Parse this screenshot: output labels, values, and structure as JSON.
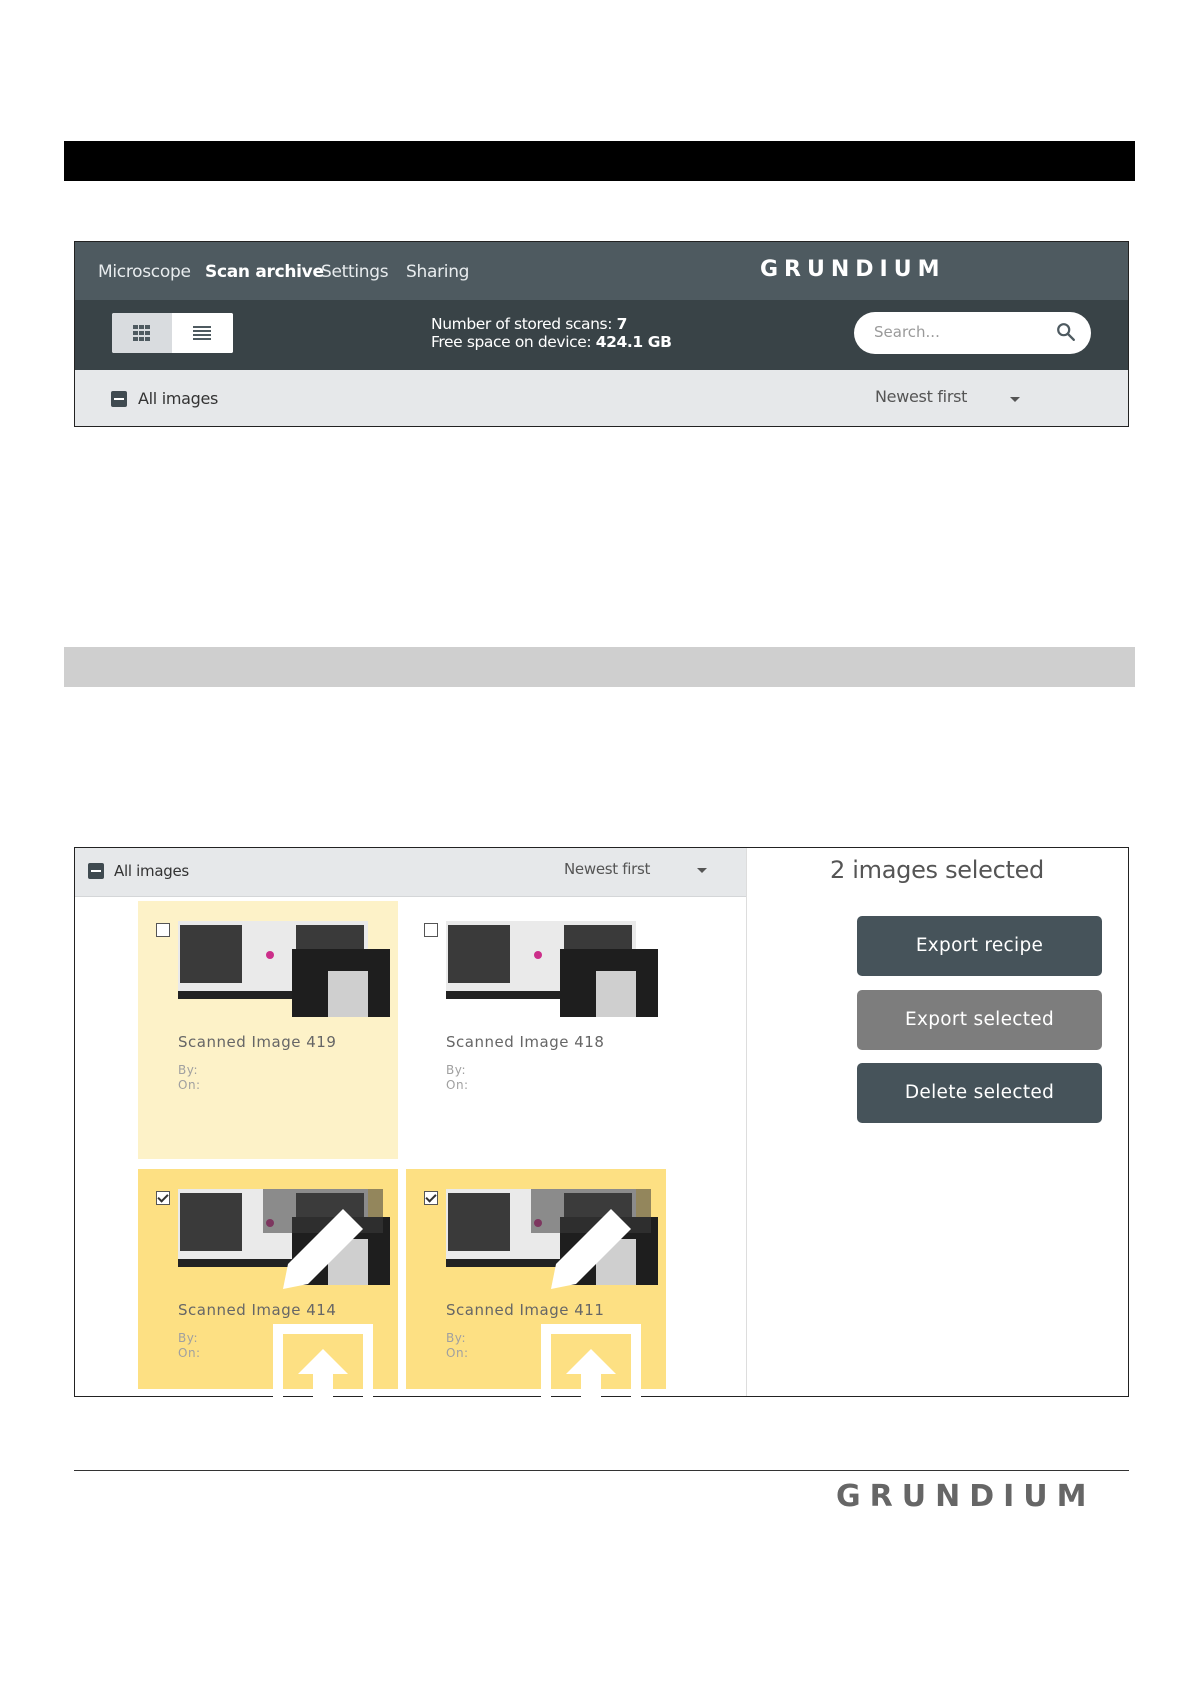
{
  "shot1": {
    "nav": [
      "Microscope",
      "Scan archive",
      "Settings",
      "Sharing"
    ],
    "active_nav": "Scan archive",
    "logo": "GRUNDIUM",
    "stats": {
      "stored_label": "Number of stored scans:",
      "stored_value": "7",
      "free_label": "Free space on device:",
      "free_value": "424.1 GB"
    },
    "search": {
      "placeholder": "Search..."
    },
    "filter": {
      "all_images": "All images",
      "sort": "Newest first"
    }
  },
  "shot2": {
    "filter": {
      "all_images": "All images",
      "sort": "Newest first"
    },
    "cards": [
      {
        "title": "Scanned Image 419",
        "by": "By:",
        "on": "On:",
        "checked": false
      },
      {
        "title": "Scanned Image 418",
        "by": "By:",
        "on": "On:",
        "checked": false
      },
      {
        "title": "Scanned Image 414",
        "by": "By:",
        "on": "On:",
        "checked": true
      },
      {
        "title": "Scanned Image 411",
        "by": "By:",
        "on": "On:",
        "checked": true
      }
    ],
    "selected_count": "2 images selected",
    "buttons": {
      "export_recipe": "Export recipe",
      "export_selected": "Export selected",
      "delete_selected": "Delete selected"
    }
  },
  "footer": {
    "logo": "GRUNDIUM"
  },
  "colors": {
    "nav_bg": "#4e5a60",
    "toolbar_bg": "#394347",
    "card_selected": "#fde083",
    "card_hover": "#fdf2c8",
    "button_dark": "#46535a",
    "button_grey": "#7d7d7d"
  }
}
